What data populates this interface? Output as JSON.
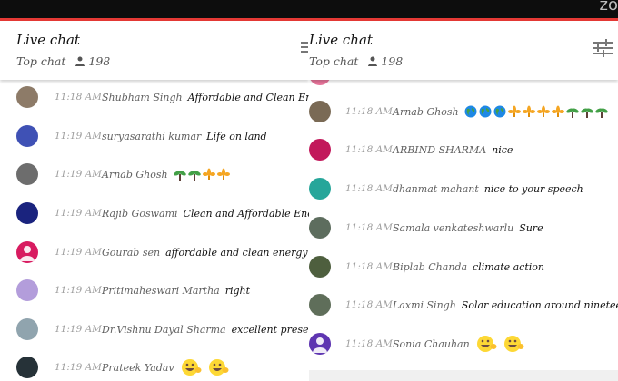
{
  "app": {
    "zoom_partial": "zo"
  },
  "left_panel": {
    "title": "Live chat",
    "subtitle": "Top chat",
    "viewer_count": "198",
    "messages": [
      {
        "time": "11:18 AM",
        "author": "Shubham Singh",
        "text": "Affordable and Clean Energy",
        "emoji": []
      },
      {
        "time": "11:19 AM",
        "author": "suryasarathi kumar",
        "text": "Life on land",
        "emoji": []
      },
      {
        "time": "11:19 AM",
        "author": "Arnab Ghosh",
        "text": "",
        "emoji": [
          "seedling-icon",
          "seedling-icon",
          "fleur-icon",
          "fleur-icon"
        ]
      },
      {
        "time": "11:19 AM",
        "author": "Rajib Goswami",
        "text": "Clean and Affordable Energy",
        "emoji": []
      },
      {
        "time": "11:19 AM",
        "author": "Gourab sen",
        "text": "affordable and clean energy",
        "emoji": []
      },
      {
        "time": "11:19 AM",
        "author": "Pritimaheswari Martha",
        "text": "right",
        "emoji": []
      },
      {
        "time": "11:19 AM",
        "author": "Dr.Vishnu Dayal Sharma",
        "text": "excellent presentation",
        "emoji": []
      },
      {
        "time": "11:19 AM",
        "author": "Prateek Yadav",
        "text": "",
        "emoji": [
          "smiley-icon",
          "smiley-icon"
        ]
      }
    ]
  },
  "right_panel": {
    "title": "Live chat",
    "subtitle": "Top chat",
    "viewer_count": "198",
    "messages": [
      {
        "time": "11:18 AM",
        "author": "Arnab Ghosh",
        "text": "",
        "emoji": [
          "globe-icon",
          "globe-icon",
          "globe-icon",
          "fleur-icon",
          "fleur-icon",
          "fleur-icon",
          "fleur-icon",
          "seedling-icon",
          "seedling-icon",
          "seedling-icon"
        ]
      },
      {
        "time": "11:18 AM",
        "author": "ARBIND SHARMA",
        "text": "nice",
        "emoji": []
      },
      {
        "time": "11:18 AM",
        "author": "dhanmat mahant",
        "text": "nice to your speech",
        "emoji": []
      },
      {
        "time": "11:18 AM",
        "author": "Samala venkateshwarlu",
        "text": "Sure",
        "emoji": []
      },
      {
        "time": "11:18 AM",
        "author": "Biplab Chanda",
        "text": "climate action",
        "emoji": []
      },
      {
        "time": "11:18 AM",
        "author": "Laxmi Singh",
        "text": "Solar education around nineteen.",
        "emoji": []
      },
      {
        "time": "11:18 AM",
        "author": "Sonia Chauhan",
        "text": "",
        "emoji": [
          "smiley-icon",
          "smiley-icon"
        ]
      }
    ]
  },
  "colors": {
    "accent_red": "#e53935",
    "top_bar": "#0d0d0d",
    "header_bg": "#ffffff",
    "time_gray": "#9e9e9e"
  }
}
